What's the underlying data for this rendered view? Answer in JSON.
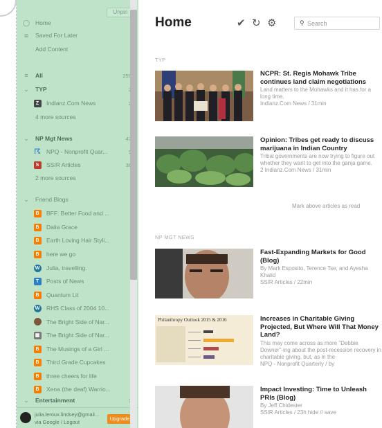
{
  "sidebar": {
    "unpin": "Unpin",
    "nav": [
      {
        "label": "Home",
        "icon": "home-icon"
      },
      {
        "label": "Saved For Later",
        "icon": "bookmark-icon"
      },
      {
        "label": "Add Content",
        "icon": ""
      }
    ],
    "all": {
      "label": "All",
      "count": "259"
    },
    "groups": {
      "typ": {
        "label": "TYP",
        "count": "2",
        "sources": [
          {
            "label": "Indianz.Com News",
            "count": "2"
          }
        ],
        "more": "4 more sources"
      },
      "npmgt": {
        "label": "NP Mgt News",
        "count": "47",
        "sources": [
          {
            "label": "NPQ - Nonprofit Quar...",
            "count": "9"
          },
          {
            "label": "SSIR Articles",
            "count": "38"
          }
        ],
        "more": "2 more sources"
      },
      "friend": {
        "label": "Friend Blogs",
        "sources": [
          {
            "label": "BFF: Better Food and ..."
          },
          {
            "label": "Dalia Grace"
          },
          {
            "label": "Earth Loving Hair Styli..."
          },
          {
            "label": "here we go"
          },
          {
            "label": "Julia, travelling."
          },
          {
            "label": "Posts of News"
          },
          {
            "label": "Quantum Lit"
          },
          {
            "label": "RHS Class of 2004 10..."
          },
          {
            "label": "The Bright Side of Nar..."
          },
          {
            "label": "The Bright Side of Nar..."
          },
          {
            "label": "The Musings of a Girl ..."
          },
          {
            "label": "Third Grade Cupcakes"
          },
          {
            "label": "three cheers for life"
          },
          {
            "label": "Xena (the deaf) Warrio..."
          }
        ]
      },
      "ent": {
        "label": "Entertainment",
        "count": "1"
      }
    },
    "footer": {
      "user": "julia.leroux.lindsey@gmail...",
      "via": "via Google / Logout",
      "upgrade": "Upgrade"
    }
  },
  "main": {
    "title": "Home",
    "search_placeholder": "Search",
    "sections": [
      {
        "label": "TYP"
      },
      {
        "label": "NP MGT NEWS"
      }
    ],
    "mark_read": "Mark above articles as read",
    "articles": [
      {
        "title": "NCPR: St. Regis Mohawk Tribe continues land claim negotiations",
        "summary": "Land matters to the Mohawks and it has for a long time.",
        "meta": "Indianz.Com News / 31min"
      },
      {
        "title": "Opinion: Tribes get ready to discuss marijuana in Indian Country",
        "summary": "Tribal governments are now trying to figure out whether they want to get into the ganja game.",
        "meta": "2 Indianz.Com News / 31min"
      },
      {
        "title": "Fast-Expanding Markets for Good (Blog)",
        "summary": "By Mark Esposito, Terence Tse, and Ayesha Khalid",
        "meta": "SSIR Articles / 22min"
      },
      {
        "title": "Increases in Charitable Giving Projected, But Where Will That Money Land?",
        "summary": "This may come across as more \"Debbie Downer\"-ing about the post-recession recovery in charitable giving, but, as in the",
        "meta": "NPQ - Nonprofit Quarterly / by"
      },
      {
        "title": "Impact Investing: Time to Unleash PRIs (Blog)",
        "summary": "By Jeff Chidester",
        "meta": "SSIR Articles / 23h    hide  // save"
      }
    ],
    "chart_caption": "Philanthropy Outlook 2015 & 2016"
  }
}
